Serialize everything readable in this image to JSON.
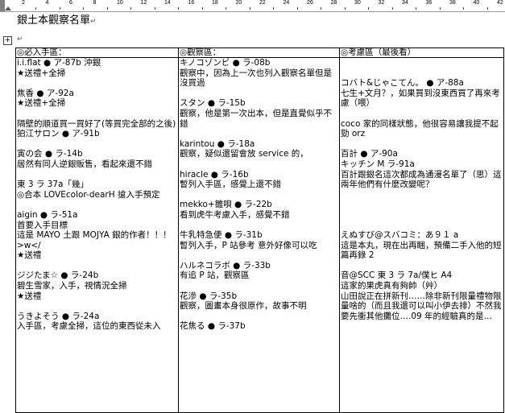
{
  "ruler": {
    "numbers": [
      "2",
      "4",
      "6",
      "8",
      "10",
      "12",
      "14",
      "16",
      "18",
      "20",
      "22",
      "24",
      "26",
      "28",
      "30",
      "32",
      "34",
      "36",
      "38",
      "40",
      "42"
    ]
  },
  "document": {
    "title": "銀土本觀察名單",
    "para_mark": "↵",
    "table_handle": "+"
  },
  "columns": [
    {
      "header": "◎必入手區：",
      "lines": [
        "i.i.flat  ●  ア-87b 沖銀",
        "★送禮+全掃",
        "",
        "焦香  ●  ア-92a",
        "★送禮+全掃",
        "",
        "隔壁的順道買一買好了(等買完全部的之後)",
        "狛江サロン  ●  ア-91b",
        "",
        "寅の会  ●  ラ-14b",
        "居然有同人逆銀販售，看起來還不錯",
        "",
        "東 3 ラ 37a「幾」",
        "◎合本 LOVEcolor-dearH  搶入手預定",
        "",
        "aigin  ●  ラ-51a",
        "首要入手目標",
        "這是 MAYO 土跟 MOJYA 銀的作者！！！>w</",
        "★送禮",
        "",
        "ジジたま☆  ●  ラ-24b",
        "碧生雪家，入手，視情況全掃",
        "★送禮",
        "",
        "うきよそう  ●  ラ-24a",
        "入手區，考慮全掃，這位的東西從未入"
      ]
    },
    {
      "header": "◎觀察區：",
      "lines": [
        "キノコゾンビ  ●  ラ-08b",
        "觀察中，因為上一次也列入觀察名單但是沒買過",
        "",
        "スタン  ●  ラ-15b",
        "觀察，他是第一次出本，但是直覺似乎不錯",
        "",
        "karintou  ●  ラ-18a",
        "觀察，疑似還留會放 service 的，",
        "",
        "hiracle  ●  ラ-16b",
        "暫列入手區，感覺上還不錯",
        "",
        "mekko+雛唄  ●  ラ-22b",
        "看到虎牛考慮入手，感覺不錯",
        "",
        "牛乳特急便  ●  ラ-31b",
        "暫列入手，P 站參考 意外好像可以吃",
        "",
        "ハルネコラボ  ●  ラ-33b",
        "有追 P 站，觀察區",
        "",
        "花滲  ●  ラ-35b",
        "觀察，圖畫本身很原作，故事不明",
        "",
        "花焦る  ●  ラ-37b"
      ]
    },
    {
      "header": "◎考慮區（最後看）",
      "lines": [
        "",
        "",
        "コバト&じゃこてん。  ●  ア-88a",
        "七生+文月？，如果買到沒東西買了再來考慮（喂）",
        "",
        "coco 家的同樣狀態，他很容易讓我提不起勁 orz",
        "",
        "百計  ●  ア-90a",
        "キッチン M  ラ-91a",
        "百計跟銀名這次都成為通漫名單了（思）這兩年他們有什麼改變呢？",
        "",
        "",
        "",
        "",
        "えぬすび@スバコミ：あ９１ a",
        "這是本丸，現在出再睏，預備二手入他的短篇再錄 2",
        "",
        "音@SCC 東 3 ラ 7a/僕ヒ A4",
        "這家的果虎真有夠帥（艸）",
        "山田說正在拼新刊……除非新刊限量禮物限量啥的（而且我還可以叫小伊去排）不然我要先衝其他攤位….09 年的經驗真的是…"
      ]
    }
  ]
}
